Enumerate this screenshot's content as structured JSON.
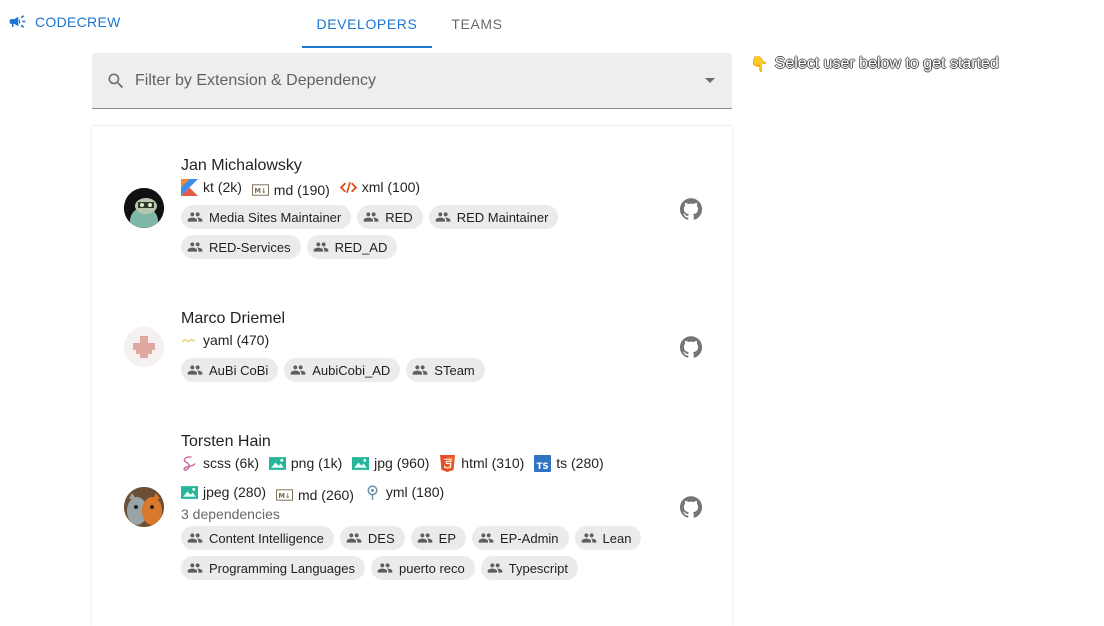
{
  "app": {
    "title": "CODECREW"
  },
  "tabs": [
    {
      "label": "DEVELOPERS",
      "active": true
    },
    {
      "label": "TEAMS",
      "active": false
    }
  ],
  "filter": {
    "placeholder": "Filter by Extension & Dependency",
    "value": ""
  },
  "hint": {
    "icon": "pointing-down-hand",
    "text": "Select user below to get started"
  },
  "colors": {
    "accent": "#1976d2",
    "chip_bg": "#ebebeb",
    "filter_bg": "#eeeeee"
  },
  "users": [
    {
      "name": "Jan Michalowsky",
      "languages": [
        {
          "icon": "kotlin-icon",
          "label": "kt (2k)"
        },
        {
          "icon": "markdown-icon",
          "label": "md (190)"
        },
        {
          "icon": "xml-icon",
          "label": "xml (100)"
        }
      ],
      "dependencies": "",
      "teams": [
        "Media Sites Maintainer",
        "RED",
        "RED Maintainer",
        "RED-Services",
        "RED_AD"
      ]
    },
    {
      "name": "Marco Driemel",
      "languages": [
        {
          "icon": "yaml-icon",
          "label": "yaml (470)"
        }
      ],
      "dependencies": "",
      "teams": [
        "AuBi CoBi",
        "AubiCobi_AD",
        "STeam"
      ]
    },
    {
      "name": "Torsten Hain",
      "languages": [
        {
          "icon": "sass-icon",
          "label": "scss (6k)"
        },
        {
          "icon": "image-icon",
          "label": "png (1k)"
        },
        {
          "icon": "image-icon",
          "label": "jpg (960)"
        },
        {
          "icon": "html5-icon",
          "label": "html (310)"
        },
        {
          "icon": "typescript-icon",
          "label": "ts (280)"
        },
        {
          "icon": "image-icon",
          "label": "jpeg (280)"
        },
        {
          "icon": "markdown-icon",
          "label": "md (260)"
        },
        {
          "icon": "yml-icon",
          "label": "yml (180)"
        }
      ],
      "dependencies": "3 dependencies",
      "teams": [
        "Content Intelligence",
        "DES",
        "EP",
        "EP-Admin",
        "Lean",
        "Programming Languages",
        "puerto reco",
        "Typescript"
      ]
    }
  ]
}
